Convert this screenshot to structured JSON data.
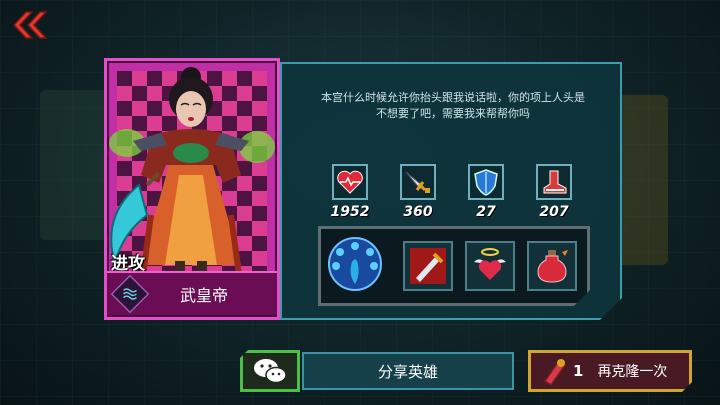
{
  "hero": {
    "role": "进攻",
    "name": "武皇帝",
    "class_icon": "wave-class-icon",
    "card_color": "#c02fa6"
  },
  "quote": "本宫什么时候允许你抬头跟我说话啦，你的项上人头是不想要了吧，需要我来帮帮你吗",
  "stats": [
    {
      "icon": "health-heart-icon",
      "value": "1952"
    },
    {
      "icon": "attack-sword-icon",
      "value": "360"
    },
    {
      "icon": "armor-shield-icon",
      "value": "27"
    },
    {
      "icon": "speed-boot-icon",
      "value": "207"
    }
  ],
  "skills": [
    {
      "icon": "peacock-skill-icon"
    },
    {
      "icon": "sword-strike-skill-icon"
    },
    {
      "icon": "angel-heart-skill-icon"
    },
    {
      "icon": "potion-skill-icon"
    }
  ],
  "buttons": {
    "share_label": "分享英雄",
    "share_icon": "wechat-icon",
    "reclone_count": "1",
    "reclone_label": "再克隆一次",
    "reclone_icon": "clone-token-icon"
  },
  "nav": {
    "back_icon": "double-chevron-left-icon"
  },
  "colors": {
    "accent_cyan": "#3e9cae",
    "accent_green": "#4cc046",
    "accent_gold": "#cfa630"
  }
}
